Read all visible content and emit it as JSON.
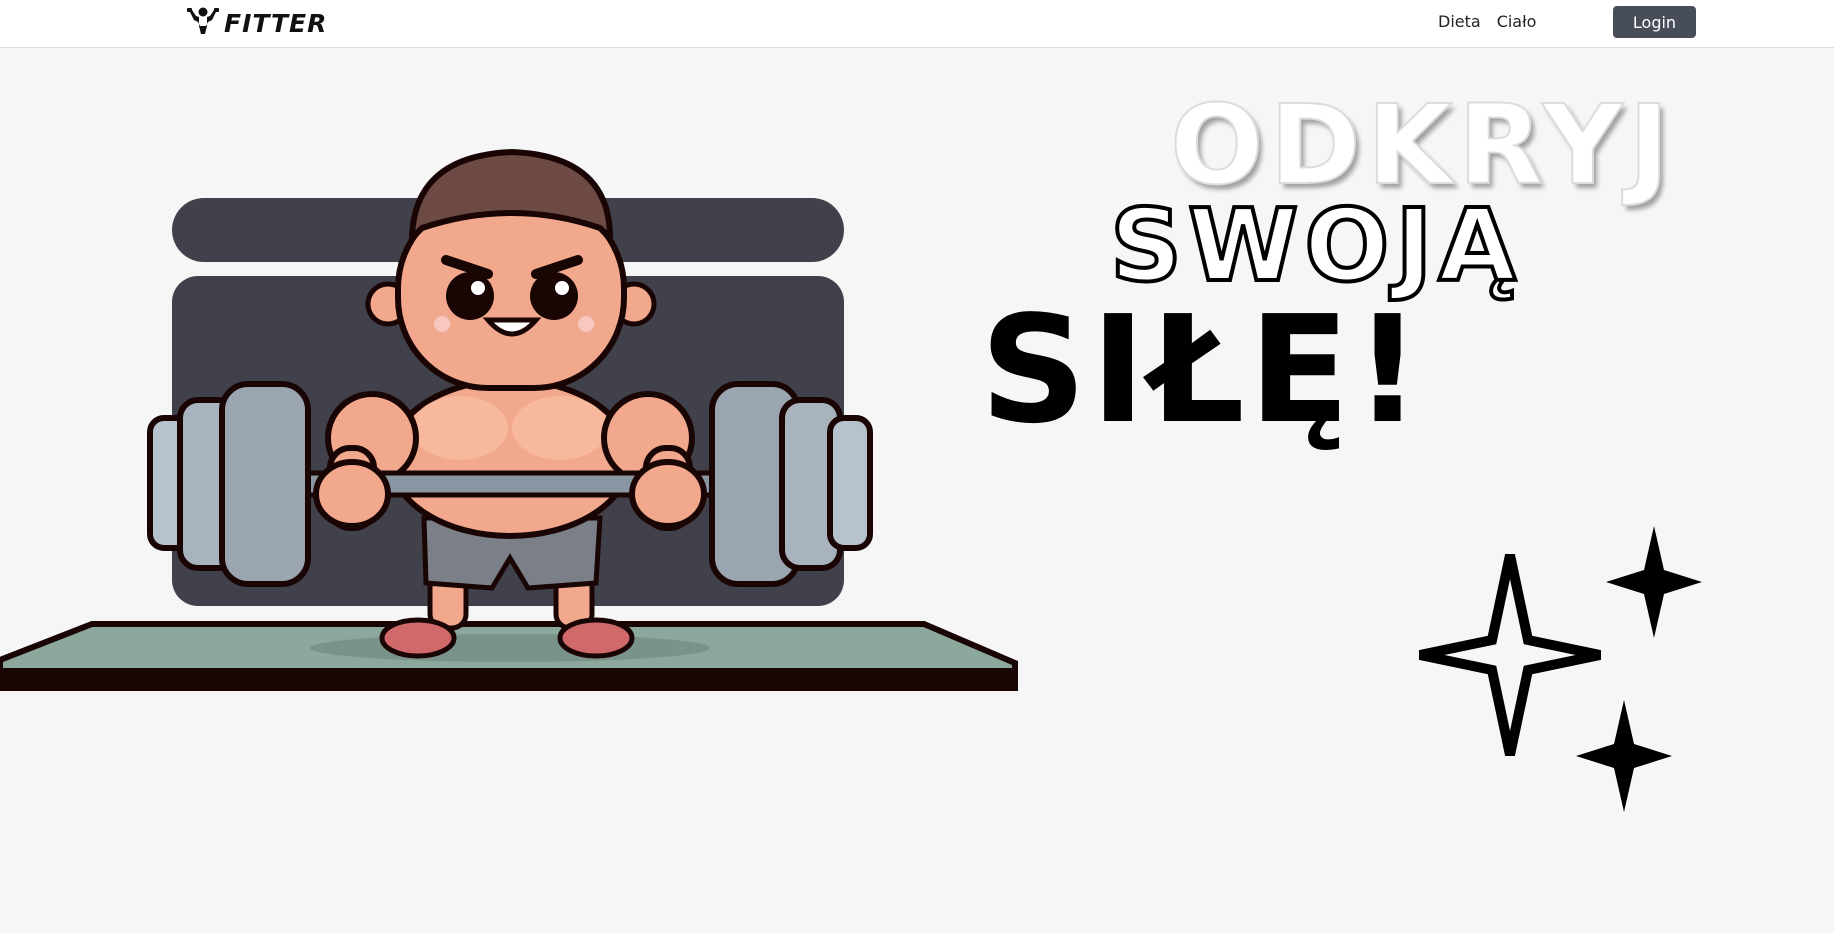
{
  "header": {
    "logo_text": "FITTER",
    "nav": [
      {
        "label": "Dieta"
      },
      {
        "label": "Ciało"
      }
    ],
    "login_label": "Login"
  },
  "hero": {
    "headline": [
      "ODKRYJ",
      "SWOJĄ",
      "SIŁĘ!"
    ],
    "illustration": "cartoon-bodybuilder-lifting-barbell",
    "decoration": "sparkles-icon"
  },
  "colors": {
    "page_bg": "#f6f6f6",
    "navbar_bg": "#ffffff",
    "button_bg": "#474d59",
    "illustration_backdrop": "#41414b",
    "mat": "#8ca89c"
  }
}
